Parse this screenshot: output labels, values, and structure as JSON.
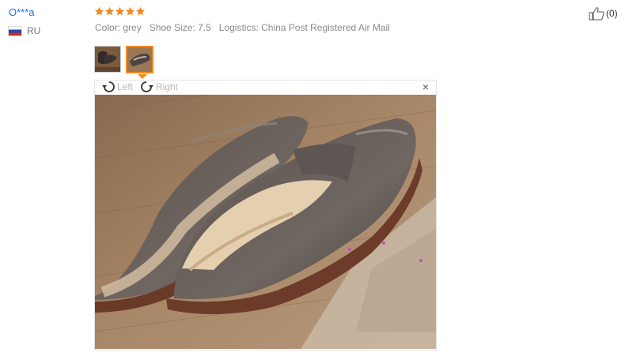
{
  "review": {
    "user_name": "O***a",
    "country_code": "RU",
    "rating": 5,
    "color": "Color: grey",
    "shoe_size": "Shoe Size: 7.5",
    "logistics": "Logistics: China Post Registered Air Mail",
    "likes": "(0)"
  },
  "viewer": {
    "rotate_left_label": "Left",
    "rotate_right_label": "Right",
    "close_label": "×"
  },
  "colors": {
    "star": "#f08a24",
    "user_link": "#2a6cc4",
    "meta_text": "#8a8a8a",
    "thumb_active_border": "#f08a24"
  },
  "icons": [
    "star-icon",
    "thumbs-up-icon",
    "rotate-left-icon",
    "rotate-right-icon",
    "close-icon",
    "flag-icon"
  ]
}
